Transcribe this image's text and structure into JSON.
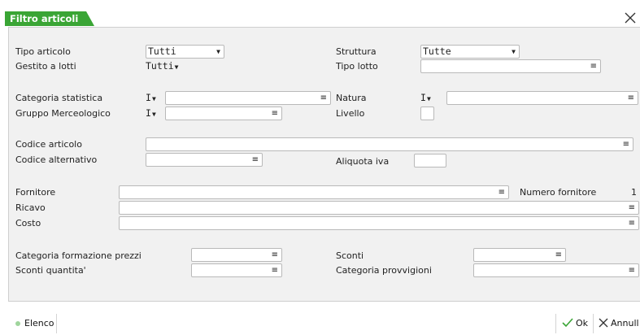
{
  "window": {
    "title": "Filtro articoli"
  },
  "fields": {
    "tipo_articolo": {
      "label": "Tipo articolo",
      "value": "Tutti"
    },
    "struttura": {
      "label": "Struttura",
      "value": "Tutte"
    },
    "gestito_a_lotti": {
      "label": "Gestito a lotti",
      "value": "Tutti"
    },
    "tipo_lotto": {
      "label": "Tipo lotto",
      "value": ""
    },
    "categoria_statistica": {
      "label": "Categoria statistica",
      "mode": "I",
      "value": ""
    },
    "natura": {
      "label": "Natura",
      "mode": "I",
      "value": ""
    },
    "gruppo_merceologico": {
      "label": "Gruppo Merceologico",
      "mode": "I",
      "value": ""
    },
    "livello": {
      "label": "Livello",
      "value": ""
    },
    "codice_articolo": {
      "label": "Codice articolo",
      "value": ""
    },
    "codice_alternativo": {
      "label": "Codice alternativo",
      "value": ""
    },
    "aliquota_iva": {
      "label": "Aliquota iva",
      "value": ""
    },
    "fornitore": {
      "label": "Fornitore",
      "value": ""
    },
    "numero_fornitore": {
      "label": "Numero fornitore",
      "value": "1"
    },
    "ricavo": {
      "label": "Ricavo",
      "value": ""
    },
    "costo": {
      "label": "Costo",
      "value": ""
    },
    "categoria_formazione_prezzi": {
      "label": "Categoria formazione prezzi",
      "value": ""
    },
    "sconti": {
      "label": "Sconti",
      "value": ""
    },
    "sconti_quantita": {
      "label": "Sconti quantita'",
      "value": ""
    },
    "categoria_provvigioni": {
      "label": "Categoria provvigioni",
      "value": ""
    }
  },
  "footer": {
    "elenco": "Elenco",
    "ok": "Ok",
    "annulla": "Annull"
  },
  "icons": {
    "list": "list-icon",
    "dropdown": "dropdown-arrow-icon",
    "close": "close-icon",
    "ok": "check-icon",
    "cancel": "cancel-x-icon"
  },
  "colors": {
    "accent": "#3aa535",
    "panel": "#f1f1f1"
  }
}
